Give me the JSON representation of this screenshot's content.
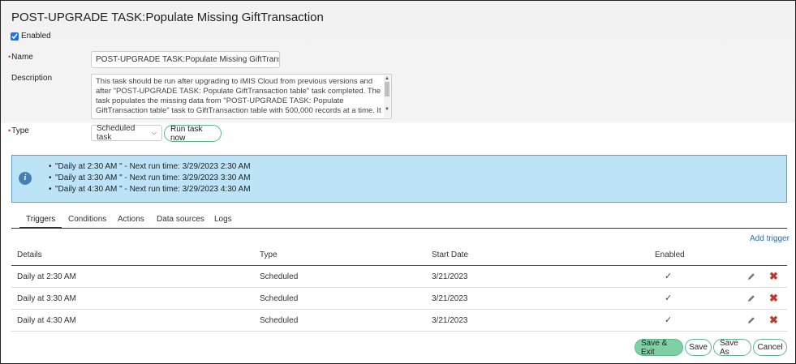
{
  "header": {
    "title": "POST-UPGRADE TASK:Populate Missing GiftTransaction"
  },
  "enabled": {
    "label": "Enabled",
    "checked": true
  },
  "form": {
    "name_label": "Name",
    "name_value": "POST-UPGRADE TASK:Populate Missing GiftTransactio",
    "description_label": "Description",
    "description_value": "This task should be run after upgrading to iMIS Cloud from previous versions and after \"POST-UPGRADE TASK: Populate GiftTransaction table\" task completed. The task populates the missing data from \"POST-UPGRADE TASK: Populate GiftTransaction table\" task to GiftTransaction table with 500,000 records at a time. It",
    "type_label": "Type",
    "type_value": "Scheduled task",
    "run_button": "Run task now"
  },
  "info": {
    "items": [
      "\"Daily at 2:30 AM \" - Next run time: 3/29/2023 2:30 AM",
      "\"Daily at 3:30 AM \" - Next run time: 3/29/2023 3:30 AM",
      "\"Daily at 4:30 AM \" - Next run time: 3/29/2023 4:30 AM"
    ]
  },
  "tabs": [
    {
      "label": "Triggers",
      "active": true
    },
    {
      "label": "Conditions"
    },
    {
      "label": "Actions"
    },
    {
      "label": "Data sources"
    },
    {
      "label": "Logs"
    }
  ],
  "triggers": {
    "add_label": "Add trigger",
    "headers": {
      "details": "Details",
      "type": "Type",
      "start_date": "Start Date",
      "enabled": "Enabled"
    },
    "rows": [
      {
        "details": "Daily at 2:30 AM",
        "type": "Scheduled",
        "start_date": "3/21/2023",
        "enabled": "✓"
      },
      {
        "details": "Daily at 3:30 AM",
        "type": "Scheduled",
        "start_date": "3/21/2023",
        "enabled": "✓"
      },
      {
        "details": "Daily at 4:30 AM",
        "type": "Scheduled",
        "start_date": "3/21/2023",
        "enabled": "✓"
      }
    ]
  },
  "footer": {
    "save_exit": "Save & Exit",
    "save": "Save",
    "save_as": "Save As",
    "cancel": "Cancel"
  },
  "colors": {
    "accent_green": "#7fd0a5",
    "info_bg": "#bde3f6",
    "link": "#2a6fa8",
    "delete_red": "#c0392b"
  }
}
